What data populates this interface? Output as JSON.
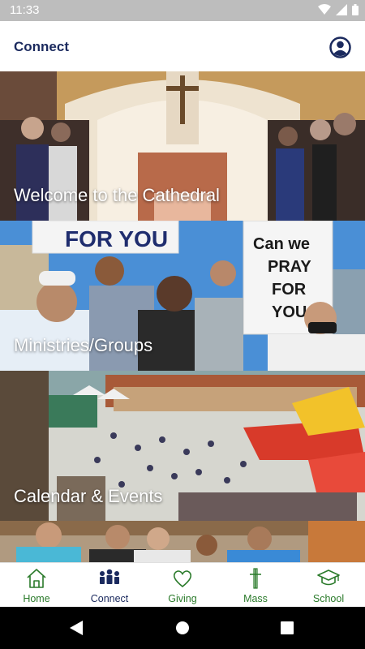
{
  "status": {
    "time": "11:33"
  },
  "header": {
    "title": "Connect"
  },
  "tiles": [
    {
      "label": "Welcome to the Cathedral"
    },
    {
      "label": "Ministries/Groups",
      "sign_left": "FOR YOU",
      "sign_right": "Can we PRAY FOR YOU"
    },
    {
      "label": "Calendar & Events"
    },
    {
      "label": ""
    }
  ],
  "nav": [
    {
      "label": "Home",
      "icon": "home-icon"
    },
    {
      "label": "Connect",
      "icon": "people-icon"
    },
    {
      "label": "Giving",
      "icon": "heart-icon"
    },
    {
      "label": "Mass",
      "icon": "cross-icon"
    },
    {
      "label": "School",
      "icon": "graduation-cap-icon"
    }
  ],
  "colors": {
    "brand": "#1b2a5e",
    "nav_green": "#2a7a2a",
    "status_bar": "#bdbdbd"
  }
}
